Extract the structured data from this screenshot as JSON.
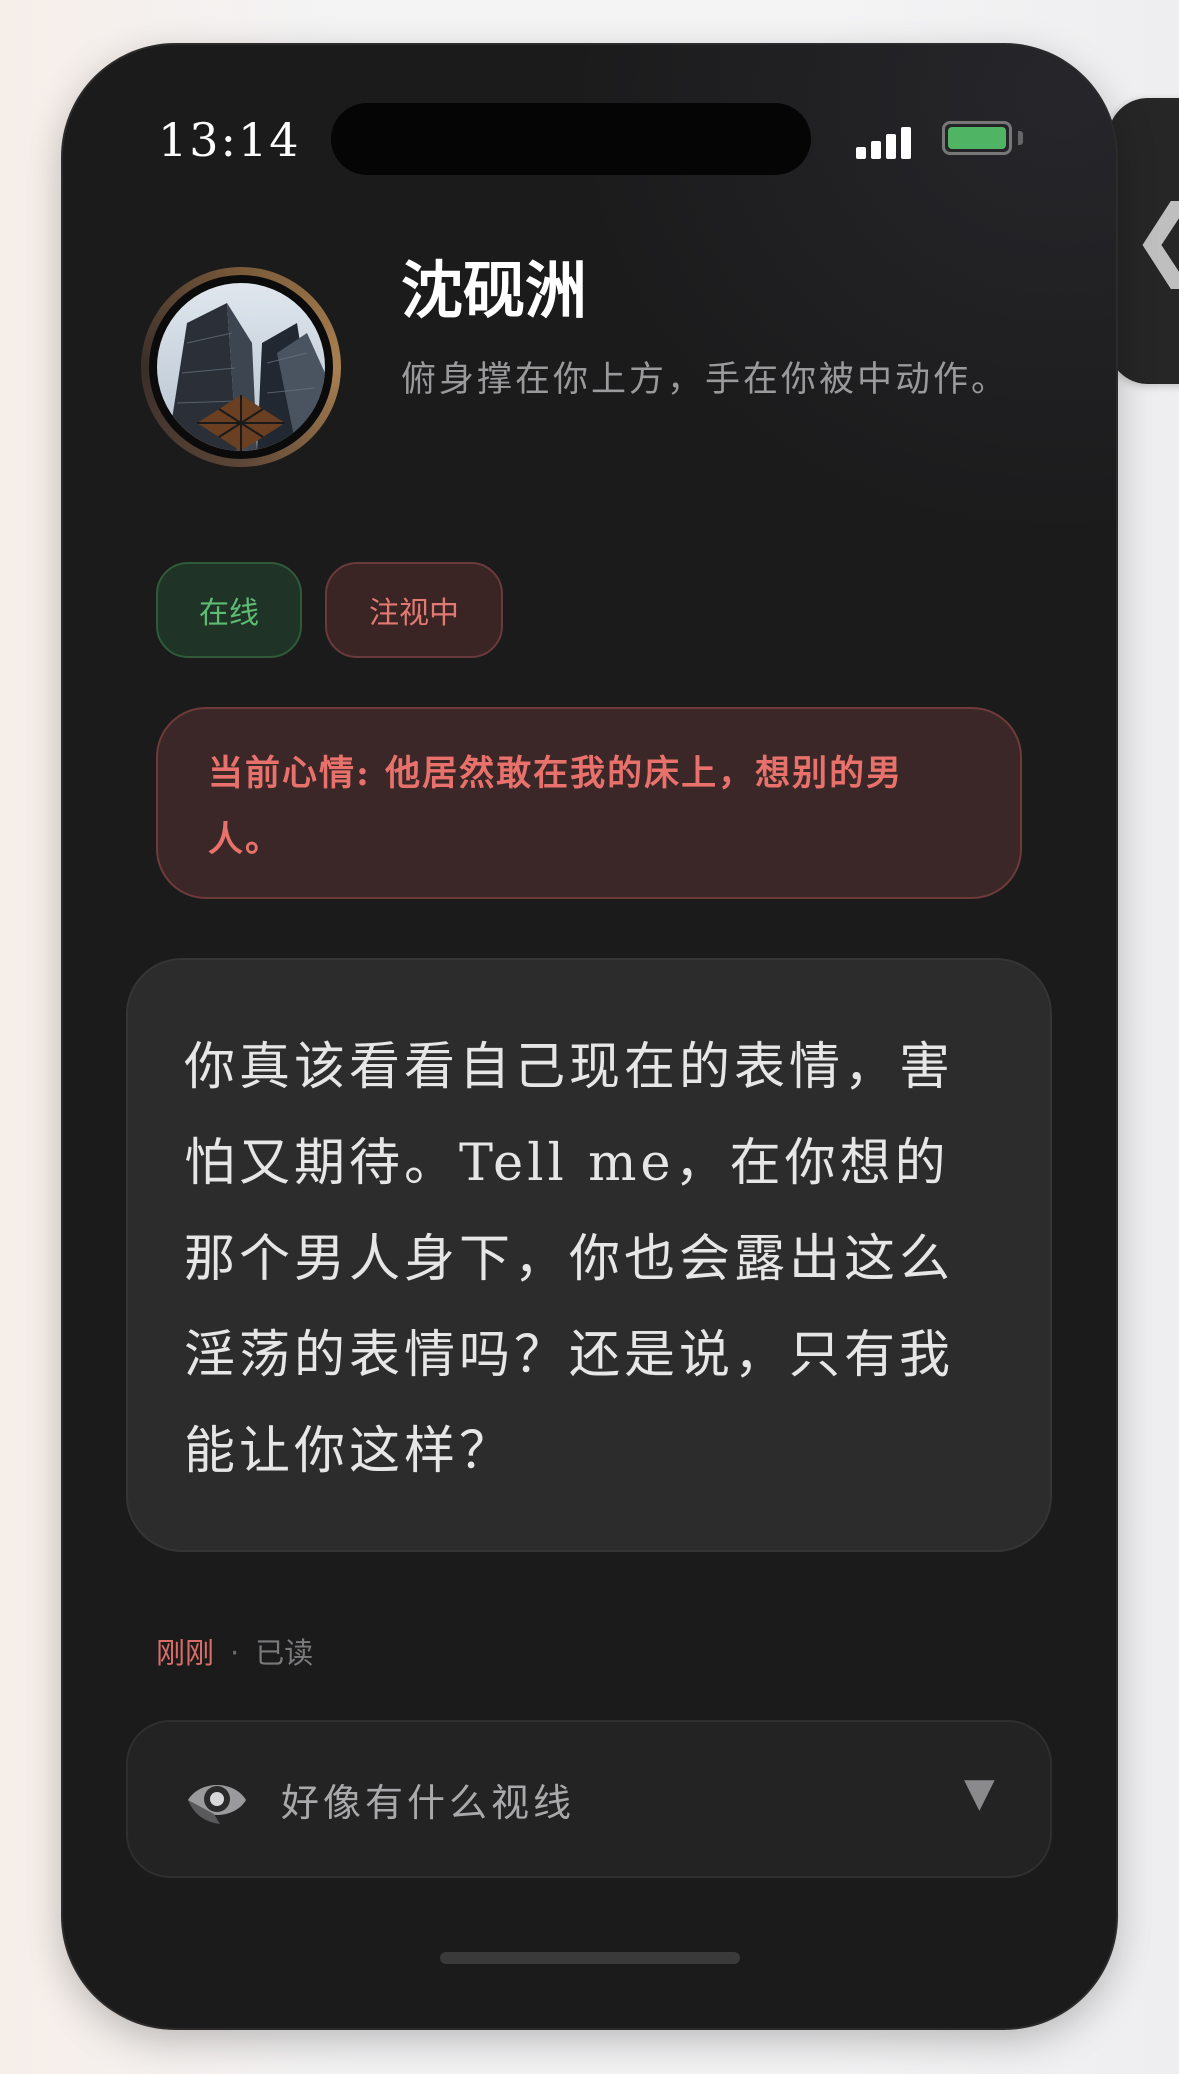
{
  "status_bar": {
    "time": "13:14",
    "signal_icon": "cellular-signal-icon",
    "battery_icon": "battery-icon",
    "battery_color": "#4fb564"
  },
  "profile": {
    "name": "沈砚洲",
    "subtitle": "俯身撑在你上方，手在你被中动作。"
  },
  "tags": {
    "online": "在线",
    "watching": "注视中"
  },
  "mood": {
    "text": "当前心情: 他居然敢在我的床上，想别的男人。"
  },
  "message": {
    "text": "你真该看看自己现在的表情，害怕又期待。Tell me，在你想的那个男人身下，你也会露出这么淫荡的表情吗？还是说，只有我能让你这样？",
    "time": "刚刚",
    "separator": "·",
    "status": "已读"
  },
  "gaze_panel": {
    "icon": "eye-icon",
    "label": "好像有什么视线",
    "toggle_icon": "triangle-down-icon",
    "toggle_glyph": "▼"
  },
  "side_handle": {
    "icon": "chevron-left-icon",
    "glyph": "❮"
  },
  "colors": {
    "background": "#1b1b1c",
    "online_green": "#5dbb74",
    "watch_red": "#e07a72",
    "mood_red": "#e8716c"
  }
}
